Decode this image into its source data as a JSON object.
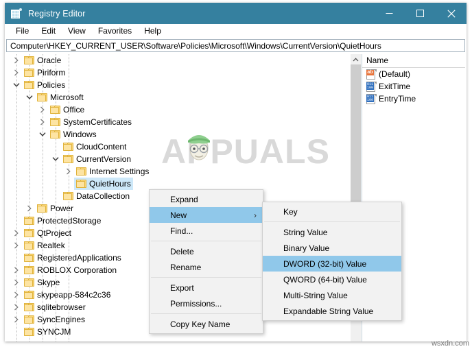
{
  "window": {
    "title": "Registry Editor",
    "icon": "registry-grid-icon",
    "titlebar_color": "#35809f",
    "controls": {
      "minimize": "—",
      "maximize": "□",
      "close": "✕"
    }
  },
  "menubar": {
    "items": [
      {
        "label": "File"
      },
      {
        "label": "Edit"
      },
      {
        "label": "View"
      },
      {
        "label": "Favorites"
      },
      {
        "label": "Help"
      }
    ]
  },
  "address": {
    "value": "Computer\\HKEY_CURRENT_USER\\Software\\Policies\\Microsoft\\Windows\\CurrentVersion\\QuietHours"
  },
  "tree": {
    "nodes": [
      {
        "label": "Oracle",
        "depth": 2,
        "expander": "collapsed",
        "selected": false
      },
      {
        "label": "Piriform",
        "depth": 2,
        "expander": "collapsed",
        "selected": false
      },
      {
        "label": "Policies",
        "depth": 2,
        "expander": "expanded",
        "selected": false
      },
      {
        "label": "Microsoft",
        "depth": 3,
        "expander": "expanded",
        "selected": false
      },
      {
        "label": "Office",
        "depth": 4,
        "expander": "collapsed",
        "selected": false
      },
      {
        "label": "SystemCertificates",
        "depth": 4,
        "expander": "collapsed",
        "selected": false
      },
      {
        "label": "Windows",
        "depth": 4,
        "expander": "expanded",
        "selected": false
      },
      {
        "label": "CloudContent",
        "depth": 5,
        "expander": "none",
        "selected": false
      },
      {
        "label": "CurrentVersion",
        "depth": 5,
        "expander": "expanded",
        "selected": false
      },
      {
        "label": "Internet Settings",
        "depth": 6,
        "expander": "collapsed",
        "selected": false
      },
      {
        "label": "QuietHours",
        "depth": 6,
        "expander": "none",
        "selected": true
      },
      {
        "label": "DataCollection",
        "depth": 5,
        "expander": "none",
        "selected": false
      },
      {
        "label": "Power",
        "depth": 3,
        "expander": "collapsed",
        "selected": false
      },
      {
        "label": "ProtectedStorage",
        "depth": 2,
        "expander": "none",
        "selected": false
      },
      {
        "label": "QtProject",
        "depth": 2,
        "expander": "collapsed",
        "selected": false
      },
      {
        "label": "Realtek",
        "depth": 2,
        "expander": "collapsed",
        "selected": false
      },
      {
        "label": "RegisteredApplications",
        "depth": 2,
        "expander": "none",
        "selected": false
      },
      {
        "label": "ROBLOX Corporation",
        "depth": 2,
        "expander": "collapsed",
        "selected": false
      },
      {
        "label": "Skype",
        "depth": 2,
        "expander": "collapsed",
        "selected": false
      },
      {
        "label": "skypeapp-584c2c36",
        "depth": 2,
        "expander": "collapsed",
        "selected": false
      },
      {
        "label": "sqlitebrowser",
        "depth": 2,
        "expander": "collapsed",
        "selected": false
      },
      {
        "label": "SyncEngines",
        "depth": 2,
        "expander": "collapsed",
        "selected": false
      },
      {
        "label": "SYNCJM",
        "depth": 2,
        "expander": "none",
        "selected": false
      }
    ]
  },
  "values": {
    "column_header": "Name",
    "rows": [
      {
        "name": "(Default)",
        "icon": "string-value-icon",
        "icon_text": "ab"
      },
      {
        "name": "ExitTime",
        "icon": "binary-value-icon",
        "icon_text": "011"
      },
      {
        "name": "EntryTime",
        "icon": "binary-value-icon",
        "icon_text": "011"
      }
    ]
  },
  "context_menu": {
    "items": [
      {
        "label": "Expand",
        "highlight": false,
        "has_submenu": false,
        "separator_after": false
      },
      {
        "label": "New",
        "highlight": true,
        "has_submenu": true,
        "separator_after": false
      },
      {
        "label": "Find...",
        "highlight": false,
        "has_submenu": false,
        "separator_after": true
      },
      {
        "label": "Delete",
        "highlight": false,
        "has_submenu": false,
        "separator_after": false
      },
      {
        "label": "Rename",
        "highlight": false,
        "has_submenu": false,
        "separator_after": true
      },
      {
        "label": "Export",
        "highlight": false,
        "has_submenu": false,
        "separator_after": false
      },
      {
        "label": "Permissions...",
        "highlight": false,
        "has_submenu": false,
        "separator_after": true
      },
      {
        "label": "Copy Key Name",
        "highlight": false,
        "has_submenu": false,
        "separator_after": false
      }
    ],
    "submenu_arrow": "›"
  },
  "submenu": {
    "items": [
      {
        "label": "Key",
        "highlight": false,
        "separator_after": true
      },
      {
        "label": "String Value",
        "highlight": false,
        "separator_after": false
      },
      {
        "label": "Binary Value",
        "highlight": false,
        "separator_after": false
      },
      {
        "label": "DWORD (32-bit) Value",
        "highlight": true,
        "separator_after": false
      },
      {
        "label": "QWORD (64-bit) Value",
        "highlight": false,
        "separator_after": false
      },
      {
        "label": "Multi-String Value",
        "highlight": false,
        "separator_after": false
      },
      {
        "label": "Expandable String Value",
        "highlight": false,
        "separator_after": false
      }
    ]
  },
  "watermarks": {
    "center": "APPUALS",
    "bottom_right": "wsxdn.com"
  }
}
